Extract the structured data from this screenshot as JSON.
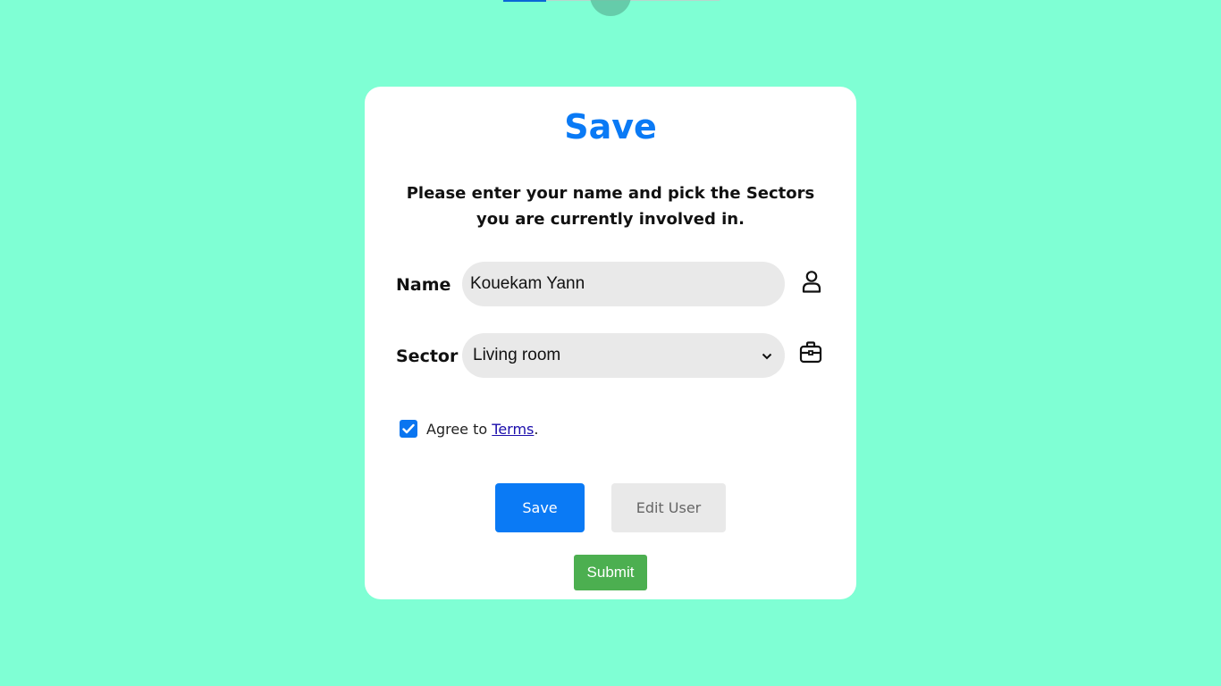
{
  "form": {
    "title": "Save",
    "intro": "Please enter your name and pick the Sectors you are currently involved in.",
    "name_label": "Name",
    "name_value": "Kouekam Yann",
    "sector_label": "Sector",
    "sector_selected": "Living room",
    "agree_text": "Agree to",
    "terms_link": "Terms",
    "agree_suffix": ".",
    "agree_checked": true
  },
  "buttons": {
    "save": "Save",
    "edit_user": "Edit User",
    "submit": "Submit"
  },
  "colors": {
    "background": "#7fffd4",
    "accent": "#0a7af5",
    "submit": "#4caf50"
  },
  "icons": {
    "name_field": "user-icon",
    "sector_field": "briefcase-icon",
    "select_arrow": "chevron-down-icon",
    "checkbox": "checkmark-icon"
  }
}
